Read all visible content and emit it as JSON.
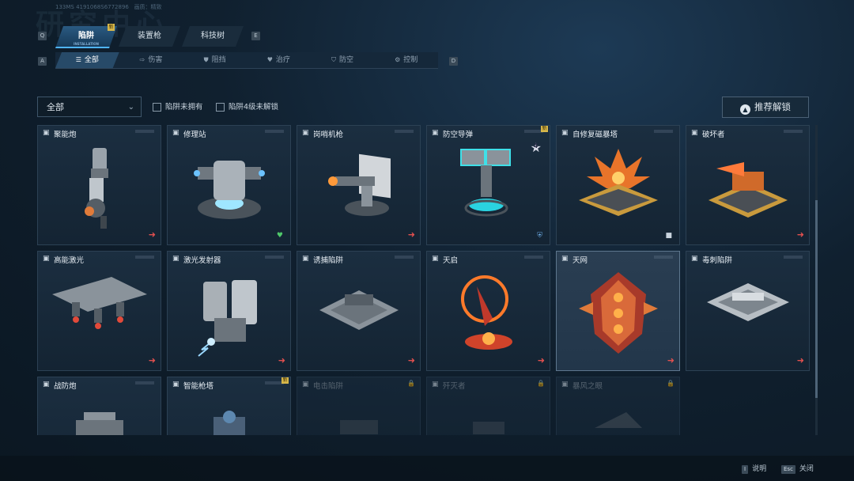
{
  "header": {
    "bg_title": "研究中心",
    "uid": "133MS  4191068S6772896",
    "quality": "画质：精致"
  },
  "keys": {
    "prev_tab": "Q",
    "next_tab": "E",
    "prev_filter": "A",
    "next_filter": "D"
  },
  "main_tabs": [
    {
      "label": "陷阱",
      "sub": "INSTALLATION",
      "active": true,
      "new": "新"
    },
    {
      "label": "装置枪",
      "active": false
    },
    {
      "label": "科技树",
      "active": false
    }
  ],
  "filter_tabs": [
    {
      "label": "全部",
      "icon": "☰",
      "active": true
    },
    {
      "label": "伤害",
      "icon": "⇨"
    },
    {
      "label": "阻挡",
      "icon": "⛊"
    },
    {
      "label": "治疗",
      "icon": "♥"
    },
    {
      "label": "防空",
      "icon": "⛉"
    },
    {
      "label": "控制",
      "icon": "⚙"
    }
  ],
  "toolbar": {
    "dropdown_value": "全部",
    "check_not_owned": "陷阱未拥有",
    "check_lv4_locked": "陷阱4级未解锁",
    "recommend_button": "推荐解锁"
  },
  "cards": [
    {
      "name": "聚能炮",
      "art": "cannon",
      "badge": "arrow"
    },
    {
      "name": "修理站",
      "art": "repair",
      "badge": "heart"
    },
    {
      "name": "岗哨机枪",
      "art": "sentry",
      "badge": "arrow"
    },
    {
      "name": "防空导弹",
      "art": "aa",
      "badge": "shield",
      "new": "新",
      "star_level": "4"
    },
    {
      "name": "自修复磁暴塔",
      "art": "tesla",
      "badge": "block"
    },
    {
      "name": "破坏者",
      "art": "breaker",
      "badge": "arrow"
    },
    {
      "name": "高能激光",
      "art": "laser",
      "badge": "arrow"
    },
    {
      "name": "激光发射器",
      "art": "emitter",
      "badge": "arrow"
    },
    {
      "name": "诱捕陷阱",
      "art": "lure",
      "badge": "arrow"
    },
    {
      "name": "天启",
      "art": "apoc",
      "badge": "arrow"
    },
    {
      "name": "天网",
      "art": "skynet",
      "badge": "arrow",
      "selected": true
    },
    {
      "name": "毒刺陷阱",
      "art": "sting",
      "badge": "arrow"
    },
    {
      "name": "战防炮",
      "art": "gun",
      "badge": ""
    },
    {
      "name": "智能枪塔",
      "art": "smart",
      "badge": "",
      "new": "新"
    },
    {
      "name": "电击陷阱",
      "art": "shock",
      "badge": "",
      "locked": true
    },
    {
      "name": "歼灭者",
      "art": "annih",
      "badge": "",
      "locked": true
    },
    {
      "name": "暴风之眼",
      "art": "storm",
      "badge": "",
      "locked": true
    }
  ],
  "footer": {
    "help_key": "I",
    "help_label": "说明",
    "close_key": "Esc",
    "close_label": "关闭"
  },
  "colors": {
    "accent": "#4fb4ff",
    "arrow_red": "#e2504f",
    "new_yellow": "#d8b84a"
  }
}
